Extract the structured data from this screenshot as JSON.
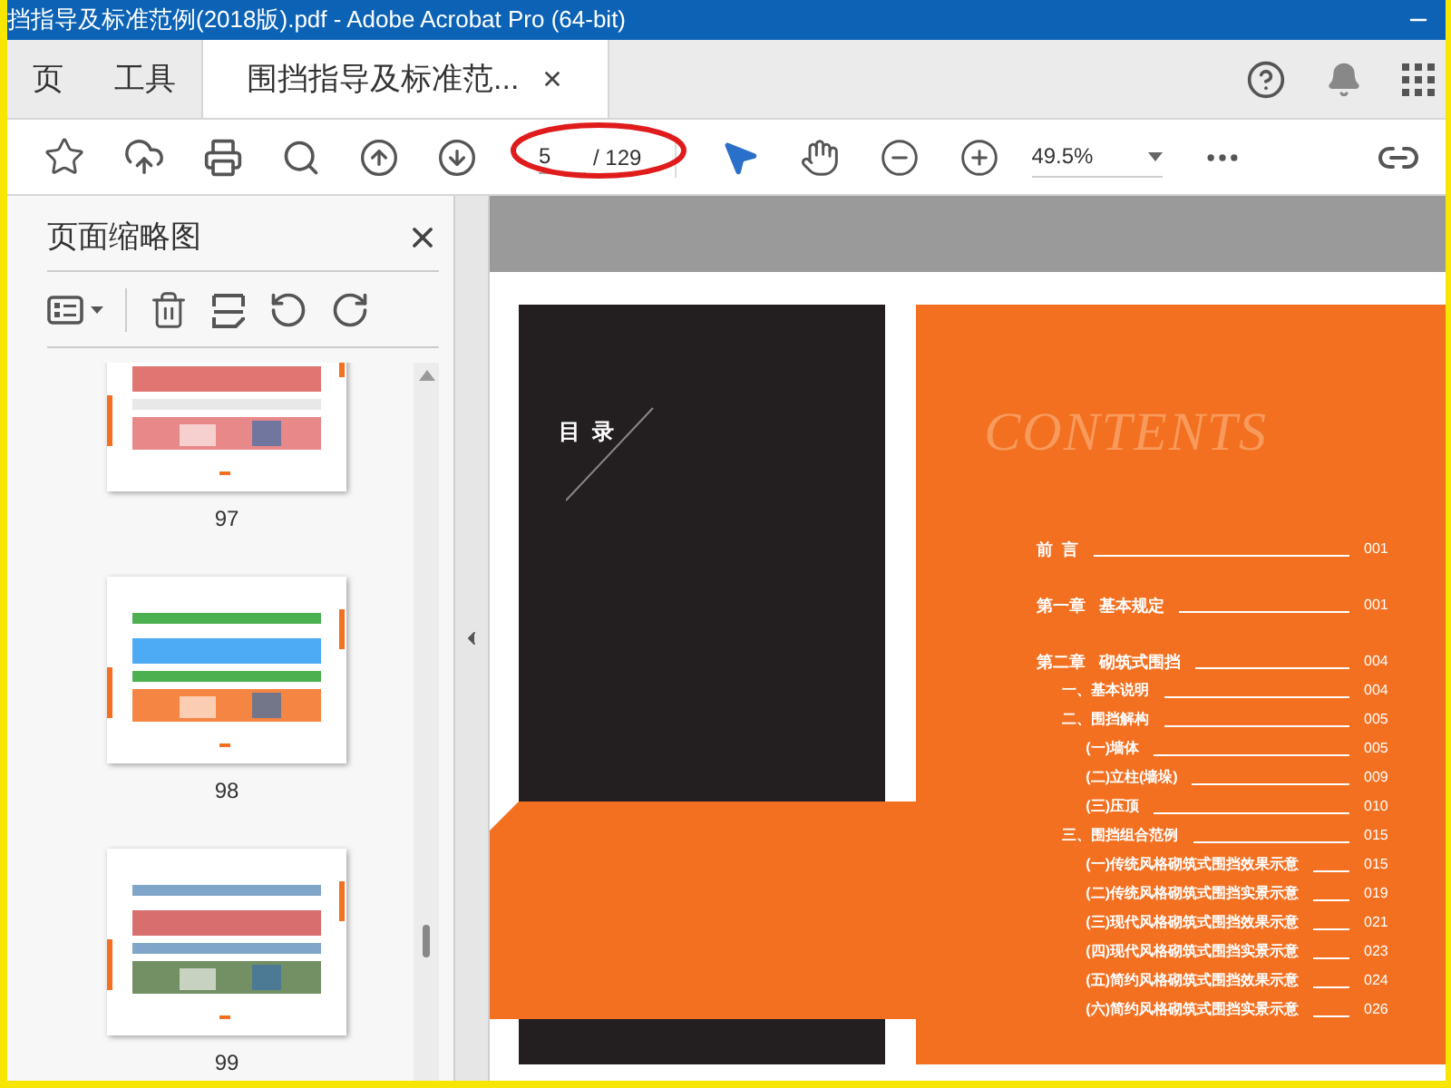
{
  "window": {
    "title": "挡指导及标准范例(2018版).pdf - Adobe Acrobat Pro (64-bit)"
  },
  "tabs": [
    {
      "label": "页",
      "selected": false
    },
    {
      "label": "工具",
      "selected": false
    },
    {
      "label": "围挡指导及标准范...",
      "selected": true
    }
  ],
  "toolbar": {
    "page_field": "5",
    "page_total": "/ 129",
    "zoom": "49.5%"
  },
  "sidebar": {
    "title": "页面缩略图",
    "thumbnails": [
      {
        "label": "97"
      },
      {
        "label": "98"
      },
      {
        "label": "99"
      }
    ]
  },
  "document": {
    "left_page": {
      "heading": "目  录"
    },
    "right_page": {
      "title": "CONTENTS",
      "toc": [
        {
          "label": "前  言",
          "page": "001"
        },
        {
          "label": "第一章   基本规定",
          "page": "001"
        },
        {
          "label": "第二章   砌筑式围挡",
          "page": "004",
          "children": [
            {
              "label": "一、基本说明",
              "page": "004"
            },
            {
              "label": "二、围挡解构",
              "page": "005",
              "children": [
                {
                  "label": "(一)墙体",
                  "page": "005"
                },
                {
                  "label": "(二)立柱(墙垛)",
                  "page": "009"
                },
                {
                  "label": "(三)压顶",
                  "page": "010"
                }
              ]
            },
            {
              "label": "三、围挡组合范例",
              "page": "015",
              "children": [
                {
                  "label": "(一)传统风格砌筑式围挡效果示意",
                  "page": "015"
                },
                {
                  "label": "(二)传统风格砌筑式围挡实景示意",
                  "page": "019"
                },
                {
                  "label": "(三)现代风格砌筑式围挡效果示意",
                  "page": "021"
                },
                {
                  "label": "(四)现代风格砌筑式围挡实景示意",
                  "page": "023"
                },
                {
                  "label": "(五)简约风格砌筑式围挡效果示意",
                  "page": "024"
                },
                {
                  "label": "(六)简约风格砌筑式围挡实景示意",
                  "page": "026"
                }
              ]
            }
          ]
        }
      ]
    }
  }
}
